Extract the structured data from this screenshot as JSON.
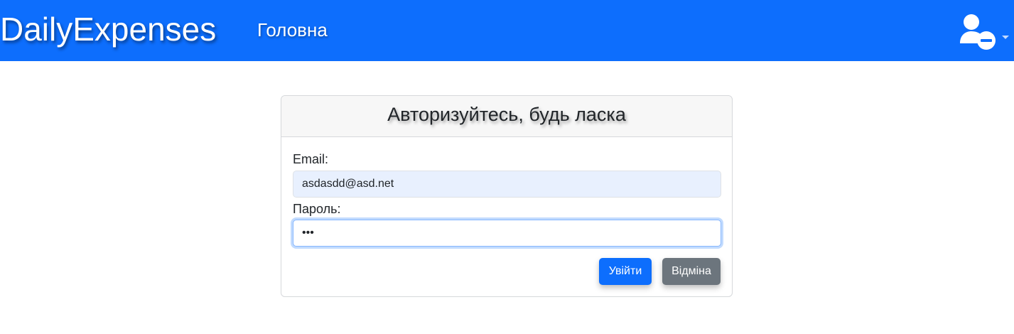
{
  "navbar": {
    "brand": "DailyExpenses",
    "home_link": "Головна",
    "user_icon": "user-minus-icon",
    "color": "#0d6efd"
  },
  "login_card": {
    "title": "Авторизуйтесь, будь ласка",
    "email_label": "Email:",
    "email_value": "asdasdd@asd.net",
    "password_label": "Пароль:",
    "password_value": "123",
    "submit_label": "Увійти",
    "cancel_label": "Відміна"
  },
  "colors": {
    "primary": "#0d6efd",
    "secondary": "#6c757d",
    "autofill_bg": "#e8f0fe"
  }
}
